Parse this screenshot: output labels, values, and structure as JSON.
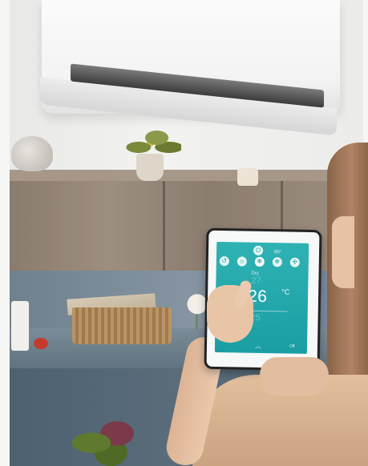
{
  "tablet": {
    "top_icons": [
      "power-icon",
      "settings-icon"
    ],
    "mode_icons": [
      "swing-icon",
      "sun-icon",
      "fan-icon",
      "snowflake-icon",
      "fan-speed-icon"
    ],
    "mode_label": "Dry",
    "set_temperature": "26",
    "unit": "°C",
    "temp_above_faint": "27",
    "temp_below_faint": "25",
    "status_text": "Off",
    "time_text": "80°"
  }
}
